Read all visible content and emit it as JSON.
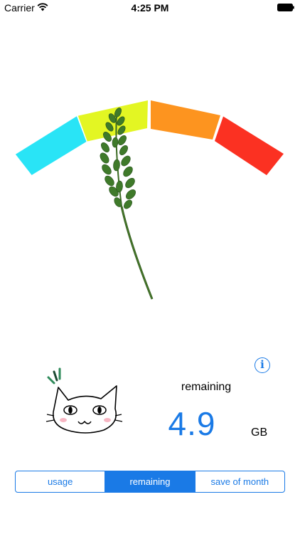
{
  "status_bar": {
    "carrier": "Carrier",
    "time": "4:25 PM",
    "wifi_icon": "wifi-icon",
    "battery_icon": "battery-icon"
  },
  "gauge": {
    "zone_colors": [
      "#29e4f6",
      "#e3f623",
      "#fd941f",
      "#fb3122"
    ],
    "needle_icon": "wheat-stalk-needle-icon"
  },
  "info": {
    "info_icon_glyph": "i",
    "remaining_label": "remaining",
    "remaining_value": "4.9",
    "unit": "GB",
    "value_color": "#1a7ae6"
  },
  "mascot": {
    "icon": "cat-face-icon"
  },
  "segmented_control": {
    "segments": [
      {
        "label": "usage",
        "selected": false
      },
      {
        "label": "remaining",
        "selected": true
      },
      {
        "label": "save of month",
        "selected": false
      }
    ]
  }
}
